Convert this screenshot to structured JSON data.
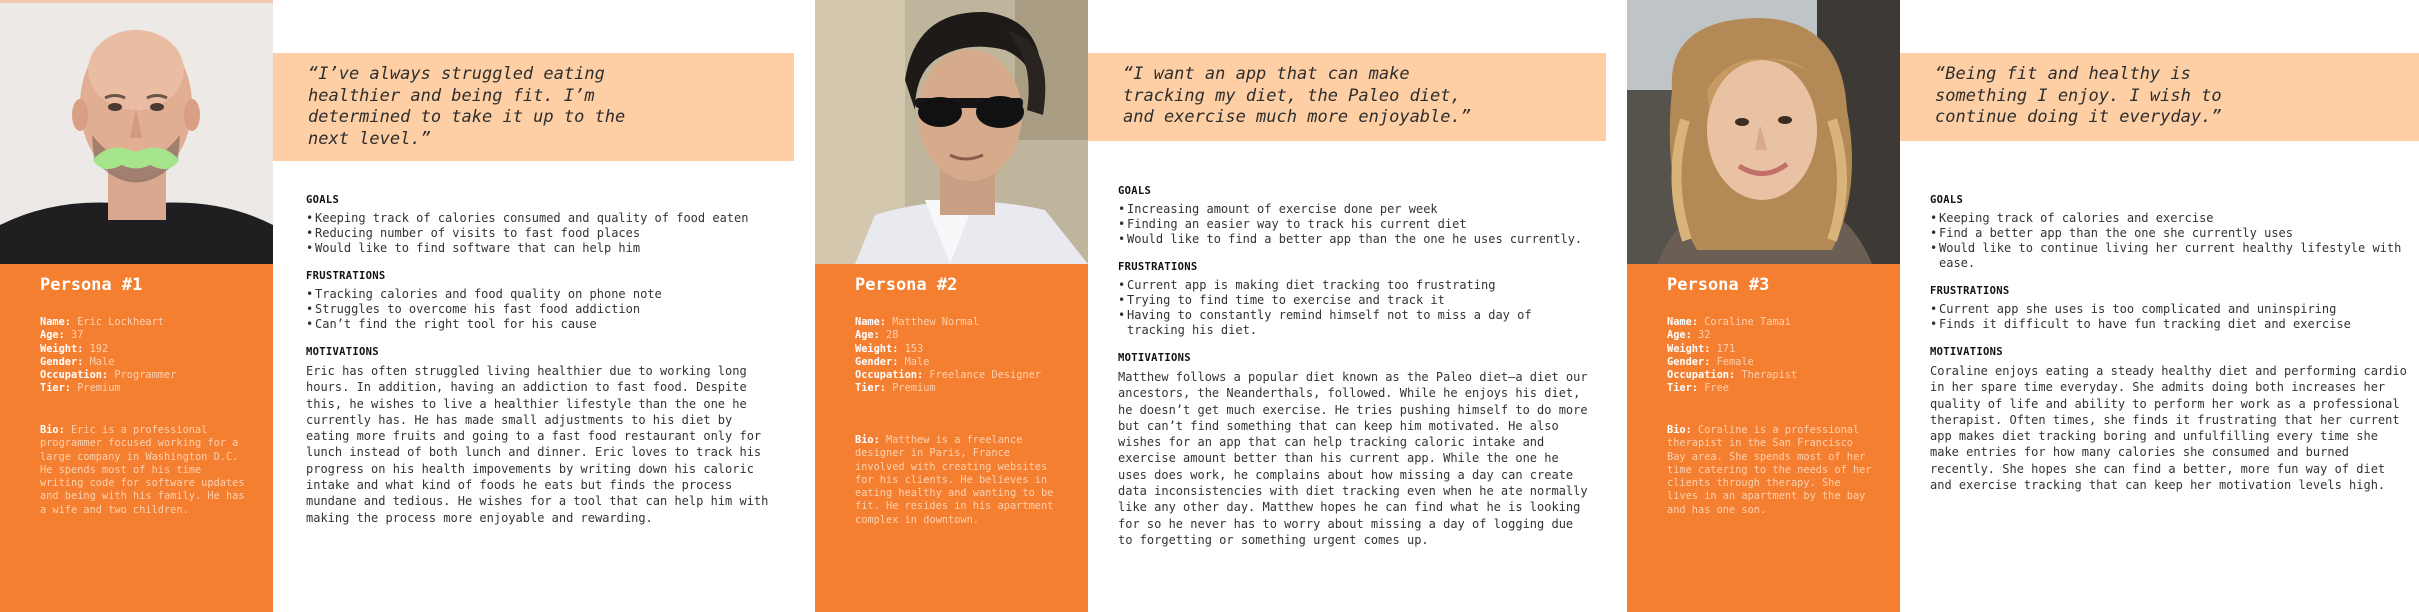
{
  "personas": [
    {
      "title": "Persona #1",
      "quote": "“I’ve always struggled eating\nhealthier and being fit. I’m\ndetermined to take it up to the\nnext level.”",
      "photo_alt": "bald man with green mustache",
      "info": {
        "name_label": "Name:",
        "name": "Eric Lockheart",
        "age_label": "Age:",
        "age": "37",
        "weight_label": "Weight:",
        "weight": "192",
        "gender_label": "Gender:",
        "gender": "Male",
        "occupation_label": "Occupation:",
        "occupation": "Programmer",
        "tier_label": "Tier:",
        "tier": "Premium"
      },
      "bio_label": "Bio:",
      "bio": "Eric is a professional programmer focused working for a large company in Washington D.C. He spends most of his time writing code for software updates and being with his family. He has a wife and two children.",
      "goals_heading": "GOALS",
      "goals": [
        "Keeping track of calories consumed and quality of food eaten",
        "Reducing number of visits to fast food places",
        "Would like to find software that can help him"
      ],
      "frustrations_heading": "FRUSTRATIONS",
      "frustrations": [
        "Tracking calories and food quality on phone note",
        "Struggles to overcome his fast food addiction",
        "Can’t find the right tool for his cause"
      ],
      "motivations_heading": "MOTIVATIONS",
      "motivations": "Eric has often struggled living healthier due to working long hours. In addition, having an addiction to fast food. Despite this, he wishes to live a healthier lifestyle than the one he currently has. He has made small adjustments to his diet by eating more fruits and going to a fast food restaurant only for lunch instead of both lunch and dinner. Eric loves to track his progress on his health impovements by writing down his caloric intake and what kind of foods he eats but finds the process mundane and tedious. He wishes for a tool that can help him with making the process more enjoyable and rewarding."
    },
    {
      "title": "Persona #2",
      "quote": "“I want an app that can make\ntracking my diet, the Paleo diet,\nand exercise much more enjoyable.”",
      "photo_alt": "man with sunglasses",
      "info": {
        "name_label": "Name:",
        "name": "Matthew Normal",
        "age_label": "Age:",
        "age": "28",
        "weight_label": "Weight:",
        "weight": "153",
        "gender_label": "Gender:",
        "gender": "Male",
        "occupation_label": "Occupation:",
        "occupation": "Freelance Designer",
        "tier_label": "Tier:",
        "tier": "Premium"
      },
      "bio_label": "Bio:",
      "bio": "Matthew is a freelance designer in Paris, France involved with creating websites for his clients. He believes in eating healthy and wanting to be fit. He resides in his apartment complex in downtown.",
      "goals_heading": "GOALS",
      "goals": [
        "Increasing amount of exercise done per week",
        "Finding an easier way to track his current diet",
        "Would like to find a better app than the one he uses currently."
      ],
      "frustrations_heading": "FRUSTRATIONS",
      "frustrations": [
        "Current app is making diet tracking too frustrating",
        "Trying to find time to exercise and track it",
        "Having to constantly remind himself not to miss a day of tracking his diet."
      ],
      "motivations_heading": "MOTIVATIONS",
      "motivations": "Matthew follows a popular diet known as the Paleo diet—a diet our ancestors, the Neanderthals, followed. While he enjoys his diet, he doesn’t get much exercise. He tries pushing himself to do more but can’t find something that can keep him motivated. He also wishes for an app that can help tracking caloric intake and exercise amount better than his current app. While the one he uses does work, he complains about how missing a day can create data inconsistencies with diet tracking even when he ate normally like any other day. Matthew hopes he can find what he is looking for so he never has to worry about missing a day of logging due to forgetting or something urgent comes up."
    },
    {
      "title": "Persona #3",
      "quote": "“Being fit and healthy is\nsomething I enjoy. I wish to\ncontinue doing it everyday.”",
      "photo_alt": "smiling woman with wavy hair",
      "info": {
        "name_label": "Name:",
        "name": "Coraline Tamai",
        "age_label": "Age:",
        "age": "32",
        "weight_label": "Weight:",
        "weight": "171",
        "gender_label": "Gender:",
        "gender": "Female",
        "occupation_label": "Occupation:",
        "occupation": "Therapist",
        "tier_label": "Tier:",
        "tier": "Free"
      },
      "bio_label": "Bio:",
      "bio": "Coraline is a professional therapist in the San Francisco Bay area. She spends most of her time catering to the needs of her clients through therapy. She lives in an apartment by the bay and has one son.",
      "goals_heading": "GOALS",
      "goals": [
        "Keeping track of calories and exercise",
        "Find a better app than the one she currently uses",
        "Would like to continue living her current healthy lifestyle with ease."
      ],
      "frustrations_heading": "FRUSTRATIONS",
      "frustrations": [
        "Current app she uses is too complicated and uninspiring",
        "Finds it difficult to have fun tracking diet and exercise"
      ],
      "motivations_heading": "MOTIVATIONS",
      "motivations": "Coraline enjoys eating a steady healthy diet and performing cardio in her spare time everyday. She admits doing both increases her quality of life and ability to perform her work as a professional therapist. Often times, she finds it frustrating that her current app makes diet tracking boring and unfulfilling every time she make entries for how many calories she consumed and burned recently. She hopes she can find a better, more fun way of diet and exercise tracking that can keep her motivation levels high."
    }
  ],
  "colors": {
    "accent_orange": "#F47F31",
    "quote_peach": "#FECFA5",
    "info_value": "#FDD0AE"
  }
}
